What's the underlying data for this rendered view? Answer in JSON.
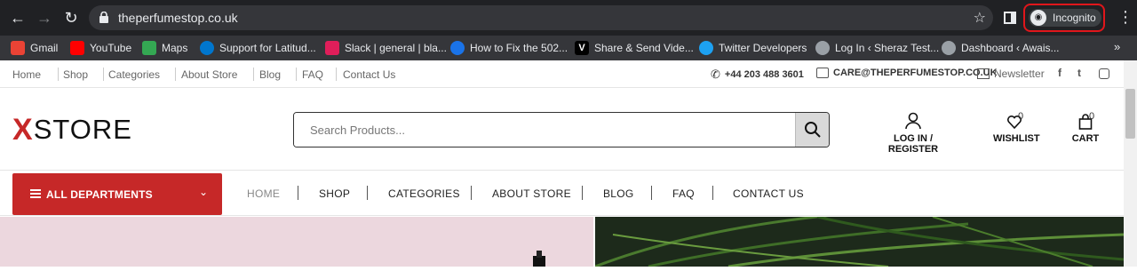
{
  "browser": {
    "url": "theperfumestop.co.uk",
    "profile_label": "Incognito",
    "bookmarks": [
      {
        "label": "Gmail",
        "icon": "gmail-icon",
        "color": "#ea4335"
      },
      {
        "label": "YouTube",
        "icon": "youtube-icon",
        "color": "#ff0000"
      },
      {
        "label": "Maps",
        "icon": "maps-icon",
        "color": "#34a853"
      },
      {
        "label": "Support for Latitud...",
        "icon": "dell-icon",
        "color": "#0076ce"
      },
      {
        "label": "Slack | general | bla...",
        "icon": "slack-icon",
        "color": "#e01e5a"
      },
      {
        "label": "How to Fix the 502...",
        "icon": "globe-icon",
        "color": "#1a73e8"
      },
      {
        "label": "Share & Send Vide...",
        "icon": "v-icon",
        "color": "#000000"
      },
      {
        "label": "Twitter Developers",
        "icon": "twitter-icon",
        "color": "#1da1f2"
      },
      {
        "label": "Log In ‹ Sheraz Test...",
        "icon": "globe-icon",
        "color": "#9aa0a6"
      },
      {
        "label": "Dashboard ‹ Awais...",
        "icon": "globe-icon",
        "color": "#9aa0a6"
      }
    ]
  },
  "topbar": {
    "links": [
      "Home",
      "Shop",
      "Categories",
      "About Store",
      "Blog",
      "FAQ",
      "Contact Us"
    ],
    "phone": "+44 203 488 3601",
    "email": "CARE@THEPERFUMESTOP.CO.UK",
    "newsletter": "Newsletter",
    "social": [
      "f",
      "t",
      "ig"
    ]
  },
  "header": {
    "logo_mark": "X",
    "logo_text": "STORE",
    "search_placeholder": "Search Products...",
    "login_label": "LOG IN / REGISTER",
    "wishlist_label": "WISHLIST",
    "wishlist_count": "0",
    "cart_label": "CART",
    "cart_count": "0"
  },
  "nav": {
    "departments_label": "ALL DEPARTMENTS",
    "links": [
      "HOME",
      "SHOP",
      "CATEGORIES",
      "ABOUT STORE",
      "BLOG",
      "FAQ",
      "CONTACT US"
    ]
  },
  "colors": {
    "brand_red": "#c62828",
    "chrome_dark": "#202124",
    "highlight_circle": "#e0161b"
  }
}
